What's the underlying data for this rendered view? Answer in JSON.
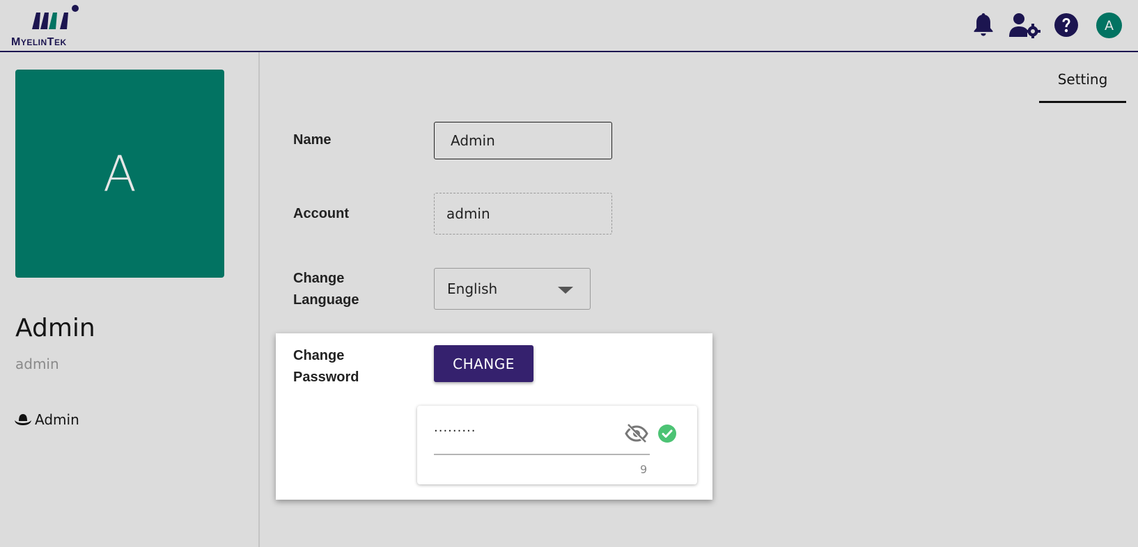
{
  "header": {
    "logo_text_big1": "M",
    "logo_text_small1": "YELIN",
    "logo_text_big2": "T",
    "logo_text_small2": "EK",
    "icons": [
      "bell-icon",
      "user-settings-icon",
      "help-icon"
    ],
    "user_initial": "A"
  },
  "sidebar": {
    "avatar_initial": "A",
    "name": "Admin",
    "account": "admin",
    "role": "Admin",
    "role_icon": "hat-icon"
  },
  "tabs": {
    "setting": "Setting"
  },
  "form": {
    "name_label": "Name",
    "name_value": "Admin",
    "account_label": "Account",
    "account_value": "admin",
    "language_label_line1": "Change",
    "language_label_line2": "Language",
    "language_value": "English",
    "password_label_line1": "Change",
    "password_label_line2": "Password",
    "change_button": "CHANGE",
    "password_masked": "·········",
    "password_length": "9"
  },
  "colors": {
    "brand": "#1c1550",
    "avatar": "#027362",
    "button": "#35216e",
    "success": "#4cc374"
  }
}
